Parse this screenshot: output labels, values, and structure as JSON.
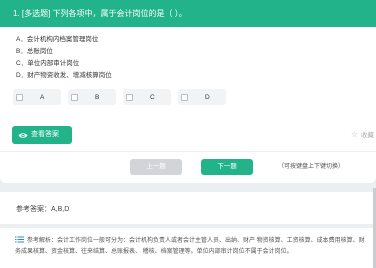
{
  "question": {
    "header": "1. [多选题] 下列各项中，属于会计岗位的是（ ）。",
    "options": [
      "A．会计机构内档案管理岗位",
      "B．总账岗位",
      "C．单位内部审计岗位",
      "D．财产物资收发、增减核算岗位"
    ],
    "answer_choices": [
      "A",
      "B",
      "C",
      "D"
    ]
  },
  "actions": {
    "view_answer": "查看答案",
    "favorite": "收藏",
    "prev": "上一题",
    "next": "下一题",
    "keyboard_hint": "（可按键盘上下键切换）"
  },
  "reference": {
    "label": "参考答案：A,B,D"
  },
  "analysis": {
    "text": "参考解析：会计工作岗位一般可分为：会计机构负责人或者会计主管人员、出纳、财产 物资核算、工资核算、成本费用核算、财务成果核算、资金核算、往来结算、总账报表、 稽核、档案管理等。单位内部审计岗位不属于会计岗位。"
  },
  "colors": {
    "accent": "#22b38a",
    "disabled": "#d1d4d8"
  },
  "icons": {
    "view": "eye-icon",
    "favorite": "star-icon",
    "analysis": "list-icon"
  }
}
